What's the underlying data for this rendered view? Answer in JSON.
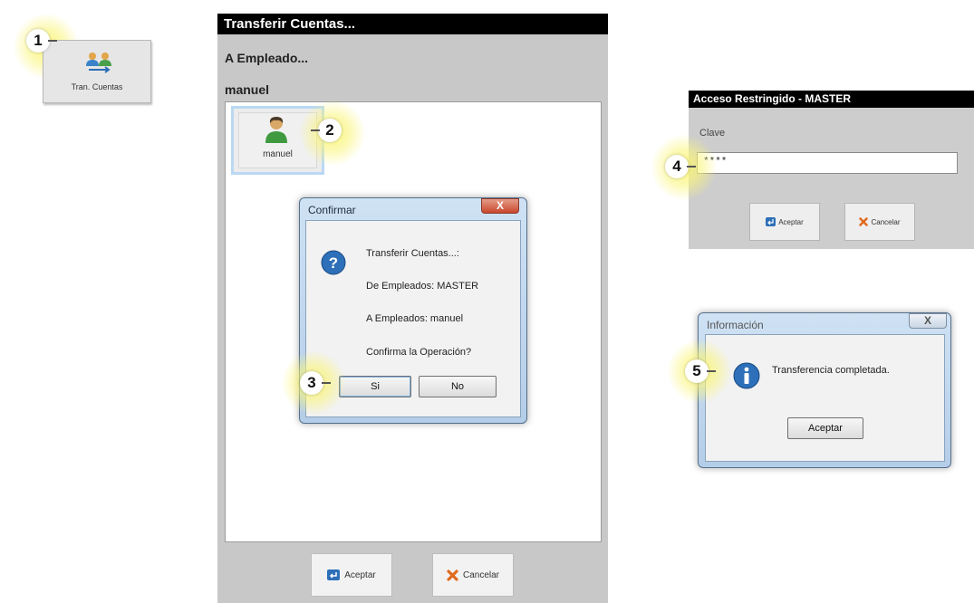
{
  "steps": {
    "s1": "1",
    "s2": "2",
    "s3": "3",
    "s4": "4",
    "s5": "5"
  },
  "tile": {
    "label": "Tran. Cuentas",
    "icon": "users-transfer-icon"
  },
  "transfer_window": {
    "title": "Transferir Cuentas...",
    "subtitle": "A Empleado...",
    "selected_employee": "manuel",
    "employee_card": {
      "name": "manuel",
      "icon": "user-icon"
    },
    "accept_label": "Aceptar",
    "cancel_label": "Cancelar"
  },
  "confirm_dialog": {
    "title": "Confirmar",
    "line1": "Transferir Cuentas...:",
    "line2": "De Empleados: MASTER",
    "line3": "A Empleados: manuel",
    "line4": "Confirma la Operación?",
    "yes_label": "Si",
    "no_label": "No",
    "close_glyph": "X",
    "icon": "question-icon"
  },
  "access_dialog": {
    "title": "Acceso Restringido - MASTER",
    "clave_label": "Clave",
    "password_value": "****",
    "accept_label": "Aceptar",
    "cancel_label": "Cancelar"
  },
  "info_dialog": {
    "title": "Información",
    "message": "Transferencia completada.",
    "accept_label": "Aceptar",
    "close_glyph": "X",
    "icon": "info-icon"
  },
  "colors": {
    "glow": "#faf578",
    "title_bar": "#000000",
    "window_bg": "#c8c8c8",
    "close_red": "#c9472c",
    "accent_blue": "#2d6fb8"
  }
}
